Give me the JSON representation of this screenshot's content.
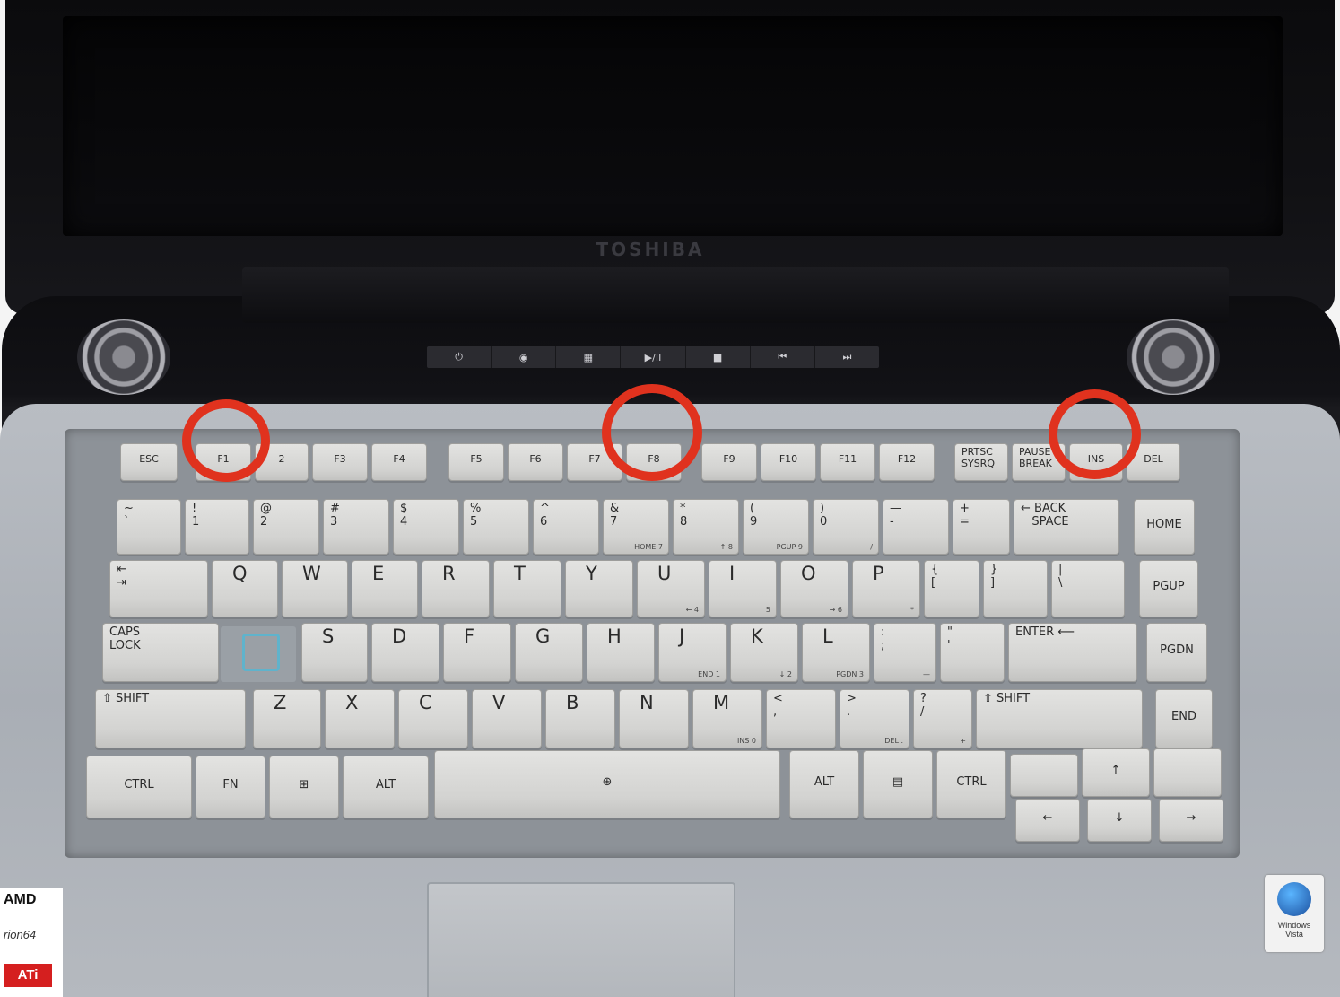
{
  "brand": "TOSHIBA",
  "media_buttons": [
    "⏻",
    "◉",
    "▦",
    "▶/II",
    "■",
    "⏮",
    "⏭"
  ],
  "badges": {
    "amd": "AMD",
    "turion": "rion64",
    "ati": "ATi",
    "vista": "Windows\nVista"
  },
  "highlight_color": "#e0321e",
  "circled_keys": [
    "F1",
    "F8",
    "INS"
  ],
  "keys": [
    {
      "id": "esc",
      "label": "ESC",
      "type": "fn"
    },
    {
      "id": "f1",
      "label": "F1",
      "type": "fn"
    },
    {
      "id": "f2",
      "label": "2",
      "type": "fn"
    },
    {
      "id": "f3",
      "label": "F3",
      "type": "fn"
    },
    {
      "id": "f4",
      "label": "F4",
      "type": "fn"
    },
    {
      "id": "f5",
      "label": "F5",
      "type": "fn"
    },
    {
      "id": "f6",
      "label": "F6",
      "type": "fn"
    },
    {
      "id": "f7",
      "label": "F7",
      "type": "fn"
    },
    {
      "id": "f8",
      "label": "F8",
      "type": "fn"
    },
    {
      "id": "f9",
      "label": "F9",
      "type": "fn"
    },
    {
      "id": "f10",
      "label": "F10",
      "type": "fn"
    },
    {
      "id": "f11",
      "label": "F11",
      "type": "fn"
    },
    {
      "id": "f12",
      "label": "F12",
      "type": "fn"
    },
    {
      "id": "prtsc",
      "label": "PRTSC\nSYSRQ",
      "type": "fn"
    },
    {
      "id": "pause",
      "label": "PAUSE\nBREAK",
      "type": "fn"
    },
    {
      "id": "ins",
      "label": "INS",
      "type": "fn"
    },
    {
      "id": "del",
      "label": "DEL",
      "type": "fn"
    },
    {
      "id": "tilde",
      "label": "~\n`",
      "type": "mod"
    },
    {
      "id": "k1",
      "label": "!\n1",
      "type": "mod"
    },
    {
      "id": "k2",
      "label": "@\n2",
      "type": "mod"
    },
    {
      "id": "k3",
      "label": "#\n3",
      "type": "mod"
    },
    {
      "id": "k4",
      "label": "$\n4",
      "type": "mod"
    },
    {
      "id": "k5",
      "label": "%\n5",
      "type": "mod"
    },
    {
      "id": "k6",
      "label": "^\n6",
      "type": "mod"
    },
    {
      "id": "k7",
      "label": "&\n7",
      "sub": "HOME 7",
      "type": "mod"
    },
    {
      "id": "k8",
      "label": "*\n8",
      "sub": "↑ 8",
      "type": "mod"
    },
    {
      "id": "k9",
      "label": "(\n9",
      "sub": "PGUP 9",
      "type": "mod"
    },
    {
      "id": "k0",
      "label": ")\n0",
      "sub": "/",
      "type": "mod"
    },
    {
      "id": "minus",
      "label": "—\n-",
      "type": "mod"
    },
    {
      "id": "equal",
      "label": "+\n=",
      "type": "mod"
    },
    {
      "id": "backspace",
      "label": "← BACK\n   SPACE",
      "type": "mod"
    },
    {
      "id": "home",
      "label": "HOME",
      "type": "mod"
    },
    {
      "id": "tab",
      "label": "⇤\n⇥",
      "type": "mod"
    },
    {
      "id": "q",
      "label": "Q",
      "type": "alpha"
    },
    {
      "id": "w",
      "label": "W",
      "type": "alpha"
    },
    {
      "id": "e",
      "label": "E",
      "type": "alpha"
    },
    {
      "id": "r",
      "label": "R",
      "type": "alpha"
    },
    {
      "id": "t",
      "label": "T",
      "type": "alpha"
    },
    {
      "id": "y",
      "label": "Y",
      "type": "alpha"
    },
    {
      "id": "u",
      "label": "U",
      "sub": "← 4",
      "type": "alpha"
    },
    {
      "id": "i",
      "label": "I",
      "sub": "5",
      "type": "alpha"
    },
    {
      "id": "o",
      "label": "O",
      "sub": "→ 6",
      "type": "alpha"
    },
    {
      "id": "p",
      "label": "P",
      "sub": "*",
      "type": "alpha"
    },
    {
      "id": "lbracket",
      "label": "{\n[",
      "type": "mod"
    },
    {
      "id": "rbracket",
      "label": "}\n]",
      "type": "mod"
    },
    {
      "id": "backslash",
      "label": "|\n\\",
      "type": "mod"
    },
    {
      "id": "pgup",
      "label": "PGUP",
      "type": "mod"
    },
    {
      "id": "caps",
      "label": "CAPS\nLOCK",
      "type": "mod"
    },
    {
      "id": "s",
      "label": "S",
      "type": "alpha"
    },
    {
      "id": "d",
      "label": "D",
      "type": "alpha"
    },
    {
      "id": "f",
      "label": "F",
      "type": "alpha"
    },
    {
      "id": "g",
      "label": "G",
      "type": "alpha"
    },
    {
      "id": "h",
      "label": "H",
      "type": "alpha"
    },
    {
      "id": "j",
      "label": "J",
      "sub": "END 1",
      "type": "alpha"
    },
    {
      "id": "k",
      "label": "K",
      "sub": "↓ 2",
      "type": "alpha"
    },
    {
      "id": "l",
      "label": "L",
      "sub": "PGDN 3",
      "type": "alpha"
    },
    {
      "id": "semicolon",
      "label": ":\n;",
      "sub": "—",
      "type": "mod"
    },
    {
      "id": "quote",
      "label": "\"\n'",
      "type": "mod"
    },
    {
      "id": "enter",
      "label": "ENTER ⟵",
      "type": "mod"
    },
    {
      "id": "pgdn",
      "label": "PGDN",
      "type": "mod"
    },
    {
      "id": "lshift",
      "label": "⇧ SHIFT",
      "type": "mod"
    },
    {
      "id": "z",
      "label": "Z",
      "type": "alpha"
    },
    {
      "id": "x",
      "label": "X",
      "type": "alpha"
    },
    {
      "id": "c",
      "label": "C",
      "type": "alpha"
    },
    {
      "id": "v",
      "label": "V",
      "type": "alpha"
    },
    {
      "id": "b",
      "label": "B",
      "type": "alpha"
    },
    {
      "id": "n",
      "label": "N",
      "type": "alpha"
    },
    {
      "id": "m",
      "label": "M",
      "sub": "INS 0",
      "type": "alpha"
    },
    {
      "id": "comma",
      "label": "<\n,",
      "type": "mod"
    },
    {
      "id": "period",
      "label": ">\n.",
      "sub": "DEL .",
      "type": "mod"
    },
    {
      "id": "slash",
      "label": "?\n/",
      "sub": "+",
      "type": "mod"
    },
    {
      "id": "rshift",
      "label": "⇧ SHIFT",
      "type": "mod"
    },
    {
      "id": "end",
      "label": "END",
      "type": "mod"
    },
    {
      "id": "lctrl",
      "label": "CTRL",
      "type": "mod"
    },
    {
      "id": "fnkey",
      "label": "FN",
      "type": "mod"
    },
    {
      "id": "win",
      "label": "⊞",
      "type": "mod"
    },
    {
      "id": "lalt",
      "label": "ALT",
      "type": "mod"
    },
    {
      "id": "space",
      "label": "⊕",
      "type": "mod"
    },
    {
      "id": "ralt",
      "label": "ALT",
      "type": "mod"
    },
    {
      "id": "menu",
      "label": "▤",
      "type": "mod"
    },
    {
      "id": "rctrl",
      "label": "CTRL",
      "type": "mod"
    },
    {
      "id": "blank1",
      "label": "",
      "type": "mod"
    },
    {
      "id": "up",
      "label": "↑",
      "type": "mod"
    },
    {
      "id": "blank2",
      "label": "",
      "type": "mod"
    },
    {
      "id": "left",
      "label": "←",
      "type": "mod"
    },
    {
      "id": "down",
      "label": "↓",
      "type": "mod"
    },
    {
      "id": "right",
      "label": "→",
      "type": "mod"
    }
  ]
}
